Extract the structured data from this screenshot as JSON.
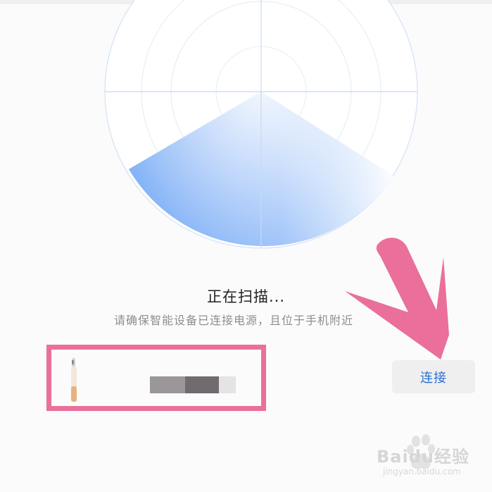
{
  "scan": {
    "title": "正在扫描...",
    "subtitle": "请确保智能设备已连接电源，且位于手机附近"
  },
  "device": {
    "icon": "toothbrush-icon",
    "name_visible": false
  },
  "actions": {
    "connect_label": "连接"
  },
  "colors": {
    "accent": "#2a6fd6",
    "radar_fill": "#6ea6f5",
    "highlight": "#ea6f9a"
  },
  "watermark": {
    "text": "Baidu经验",
    "url": "jingyan.baidu.com"
  }
}
